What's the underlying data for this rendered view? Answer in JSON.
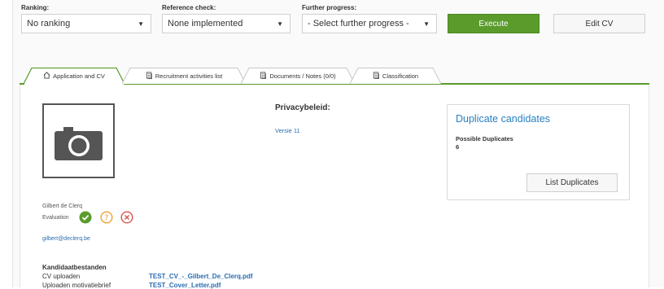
{
  "filters": {
    "ranking": {
      "label": "Ranking:",
      "value": "No ranking"
    },
    "reference_check": {
      "label": "Reference check:",
      "value": "None implemented"
    },
    "further_progress": {
      "label": "Further progress:",
      "value": "- Select further progress -"
    }
  },
  "actions": {
    "execute": "Execute",
    "edit_cv": "Edit CV"
  },
  "tabs": [
    {
      "label": "Application and CV",
      "icon": "home-icon",
      "active": true
    },
    {
      "label": "Recruitment activities list",
      "icon": "document-icon",
      "active": false
    },
    {
      "label": "Documents / Notes (0/0)",
      "icon": "document-icon",
      "active": false
    },
    {
      "label": "Classification",
      "icon": "document-icon",
      "active": false
    }
  ],
  "candidate": {
    "name": "Gilbert de Clerq",
    "evaluation_label": "Evaluation",
    "email": "gilbert@declerq.be"
  },
  "privacy": {
    "title": "Privacybeleid:",
    "version_link": "Versie 11"
  },
  "duplicates": {
    "title": "Duplicate candidates",
    "possible_label": "Possible Duplicates",
    "count": "6",
    "list_button": "List Duplicates"
  },
  "files": {
    "title": "Kandidaatbestanden",
    "rows": [
      {
        "label": "CV uploaden",
        "file": "TEST_CV_-_Gilbert_De_Clerq.pdf"
      },
      {
        "label": "Uploaden motivatiebrief",
        "file": "TEST_Cover_Letter.pdf"
      }
    ]
  },
  "colors": {
    "accent_green": "#5a9b2c",
    "link_blue": "#2a6db0",
    "reject_red": "#d9534f",
    "question_orange": "#f0a030"
  }
}
